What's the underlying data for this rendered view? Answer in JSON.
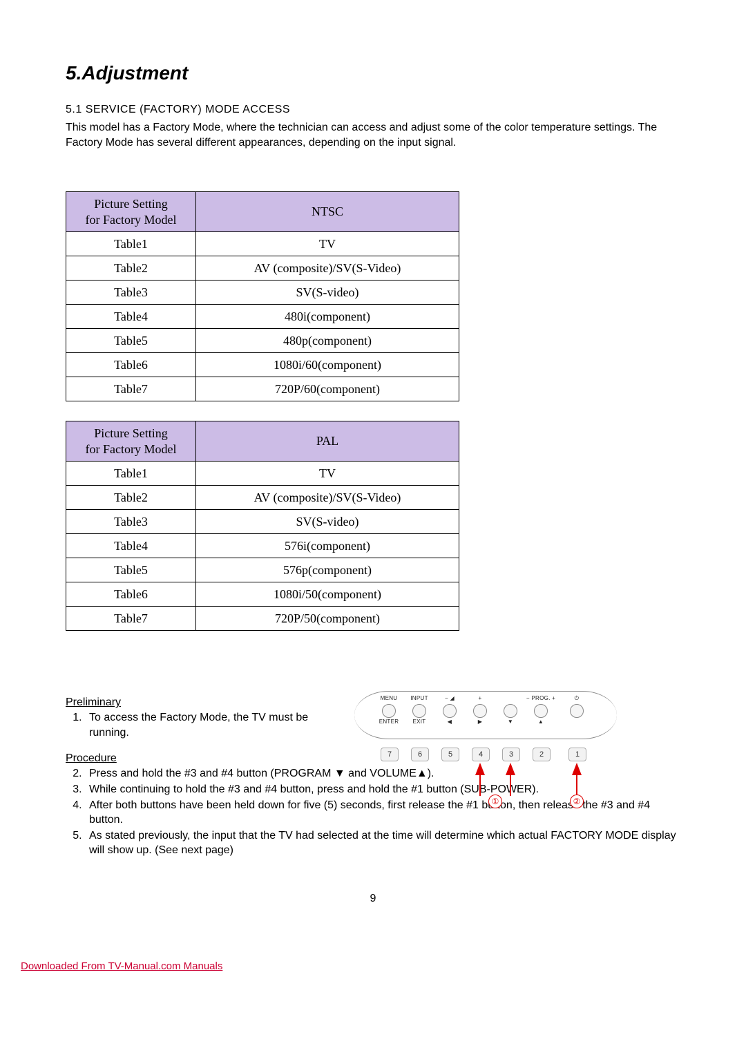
{
  "title": "5.Adjustment",
  "section_heading": "5.1 SERVICE (FACTORY) MODE ACCESS",
  "intro": "This model has a Factory Mode, where the technician can access and adjust some of the color temperature settings. The Factory Mode has several different appearances, depending on the input signal.",
  "tables": [
    {
      "left_header_line1": "Picture Setting",
      "left_header_line2": "for Factory Model",
      "right_header": "NTSC",
      "rows": [
        {
          "name": "Table1",
          "value": "TV"
        },
        {
          "name": "Table2",
          "value": "AV (composite)/SV(S-Video)"
        },
        {
          "name": "Table3",
          "value": "SV(S-video)"
        },
        {
          "name": "Table4",
          "value": "480i(component)"
        },
        {
          "name": "Table5",
          "value": "480p(component)"
        },
        {
          "name": "Table6",
          "value": "1080i/60(component)"
        },
        {
          "name": "Table7",
          "value": "720P/60(component)"
        }
      ]
    },
    {
      "left_header_line1": "Picture Setting",
      "left_header_line2": "for Factory Model",
      "right_header": "PAL",
      "rows": [
        {
          "name": "Table1",
          "value": "TV"
        },
        {
          "name": "Table2",
          "value": "AV (composite)/SV(S-Video)"
        },
        {
          "name": "Table3",
          "value": "SV(S-video)"
        },
        {
          "name": "Table4",
          "value": "576i(component)"
        },
        {
          "name": "Table5",
          "value": "576p(component)"
        },
        {
          "name": "Table6",
          "value": "1080i/50(component)"
        },
        {
          "name": "Table7",
          "value": "720P/50(component)"
        }
      ]
    }
  ],
  "preliminary_heading": "Preliminary",
  "preliminary_step": "To access the Factory Mode, the TV must be running.",
  "procedure_heading": "Procedure",
  "procedure_steps": [
    "Press and hold the #3 and #4 button (PROGRAM ▼ and VOLUME▲).",
    "While continuing to hold the #3 and #4 button, press and hold the #1 button (SUB-POWER).",
    "After both buttons have been held down for five (5) seconds, first release the #1 button, then release the #3 and #4 button.",
    "As stated previously, the input that the TV had selected at the time will determine which actual FACTORY MODE display will show up. (See next page)"
  ],
  "remote": {
    "buttons": [
      {
        "top": "MENU",
        "bot": "ENTER"
      },
      {
        "top": "INPUT",
        "bot": "EXIT"
      },
      {
        "top": "−   ◢",
        "bot": "◀"
      },
      {
        "top": "+",
        "bot": "▶"
      },
      {
        "top": "",
        "bot": "▼"
      },
      {
        "top": "− PROG. +",
        "bot": "▲"
      },
      {
        "top": "⏻",
        "bot": ""
      }
    ],
    "numbers": [
      "7",
      "6",
      "5",
      "4",
      "3",
      "2",
      "1"
    ],
    "callout1": "①",
    "callout2": "②"
  },
  "page_number": "9",
  "footer_link_text": "Downloaded From TV-Manual.com Manuals",
  "footer_link_href": "#"
}
